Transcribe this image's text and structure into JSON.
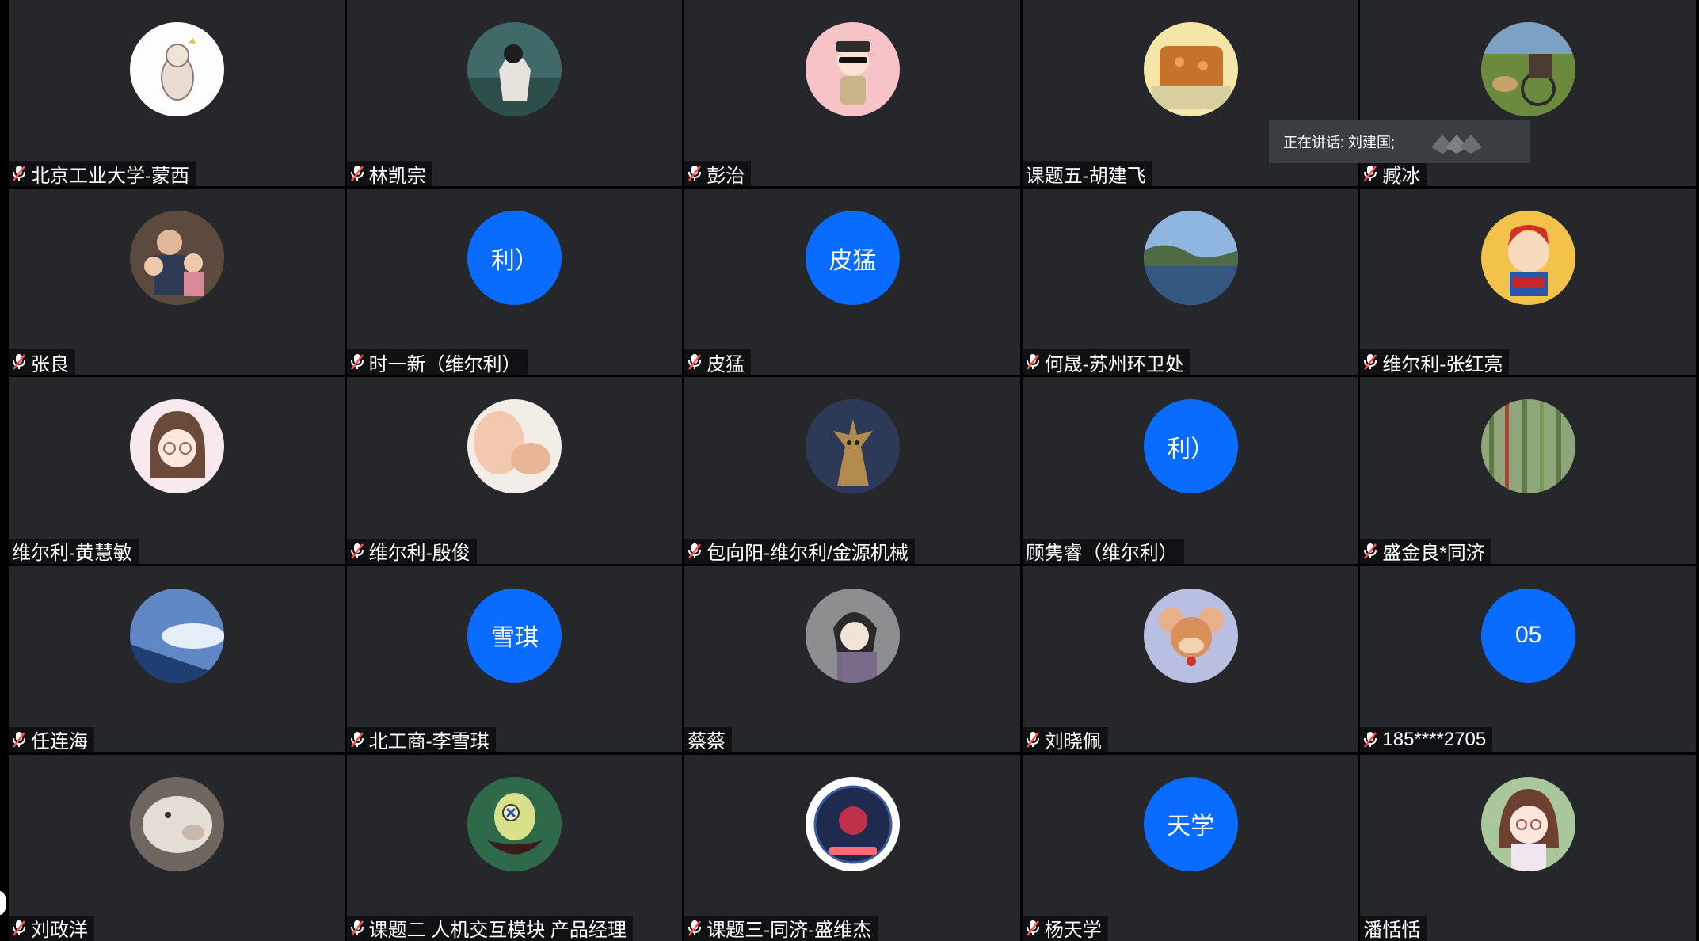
{
  "colors": {
    "tile_bg": "#25272b",
    "avatar_blue": "#0a6cff",
    "muted_red": "#ff4d4f"
  },
  "speaking": {
    "label": "正在讲话: 刘建国;"
  },
  "participants": [
    {
      "name": "北京工业大学-蒙西",
      "muted": true,
      "avatar_type": "image",
      "avatar_icon": "cat-sketch-avatar"
    },
    {
      "name": "林凯宗",
      "muted": true,
      "avatar_type": "image",
      "avatar_icon": "forest-girl-avatar"
    },
    {
      "name": "彭治",
      "muted": true,
      "avatar_type": "image",
      "avatar_icon": "cartoon-officer-avatar"
    },
    {
      "name": "课题五-胡建飞",
      "muted": false,
      "avatar_type": "image",
      "avatar_icon": "cookie-gift-avatar"
    },
    {
      "name": "臧冰",
      "muted": true,
      "avatar_type": "image",
      "avatar_icon": "rickshaw-dog-avatar"
    },
    {
      "name": "张良",
      "muted": true,
      "avatar_type": "image",
      "avatar_icon": "family-photo-avatar"
    },
    {
      "name": "时一新（维尔利）",
      "muted": true,
      "avatar_type": "text",
      "avatar_text": "利）"
    },
    {
      "name": "皮猛",
      "muted": true,
      "avatar_type": "text",
      "avatar_text": "皮猛"
    },
    {
      "name": "何晟-苏州环卫处",
      "muted": true,
      "avatar_type": "image",
      "avatar_icon": "coastline-avatar"
    },
    {
      "name": "维尔利-张红亮",
      "muted": true,
      "avatar_type": "image",
      "avatar_icon": "cartoon-boy-avatar"
    },
    {
      "name": "维尔利-黄慧敏",
      "muted": false,
      "avatar_type": "image",
      "avatar_icon": "cartoon-girl-glasses-avatar"
    },
    {
      "name": "维尔利-殷俊",
      "muted": true,
      "avatar_type": "image",
      "avatar_icon": "baby-photo-avatar"
    },
    {
      "name": "包向阳-维尔利/金源机械",
      "muted": true,
      "avatar_type": "image",
      "avatar_icon": "tree-creature-avatar"
    },
    {
      "name": "顾隽睿（维尔利）",
      "muted": false,
      "avatar_type": "text",
      "avatar_text": "利）"
    },
    {
      "name": "盛金良*同济",
      "muted": true,
      "avatar_type": "image",
      "avatar_icon": "bamboo-forest-avatar"
    },
    {
      "name": "任连海",
      "muted": true,
      "avatar_type": "image",
      "avatar_icon": "airplane-wing-avatar"
    },
    {
      "name": "北工商-李雪琪",
      "muted": true,
      "avatar_type": "text",
      "avatar_text": "雪琪"
    },
    {
      "name": "蔡蔡",
      "muted": false,
      "avatar_type": "image",
      "avatar_icon": "anime-man-avatar"
    },
    {
      "name": "刘晓佩",
      "muted": true,
      "avatar_type": "image",
      "avatar_icon": "jerry-mouse-avatar"
    },
    {
      "name": "185****2705",
      "muted": true,
      "avatar_type": "text",
      "avatar_text": "05"
    },
    {
      "name": "刘政洋",
      "muted": true,
      "avatar_type": "image",
      "avatar_icon": "sheep-avatar"
    },
    {
      "name": "课题二 人机交互模块 产品经理",
      "muted": true,
      "avatar_type": "image",
      "avatar_icon": "plankton-avatar"
    },
    {
      "name": "课题三-同济-盛维杰",
      "muted": true,
      "avatar_type": "image",
      "avatar_icon": "space-badge-avatar"
    },
    {
      "name": "杨天学",
      "muted": true,
      "avatar_type": "text",
      "avatar_text": "天学"
    },
    {
      "name": "潘恬恬",
      "muted": false,
      "avatar_type": "image",
      "avatar_icon": "cartoon-woman-avatar"
    }
  ]
}
